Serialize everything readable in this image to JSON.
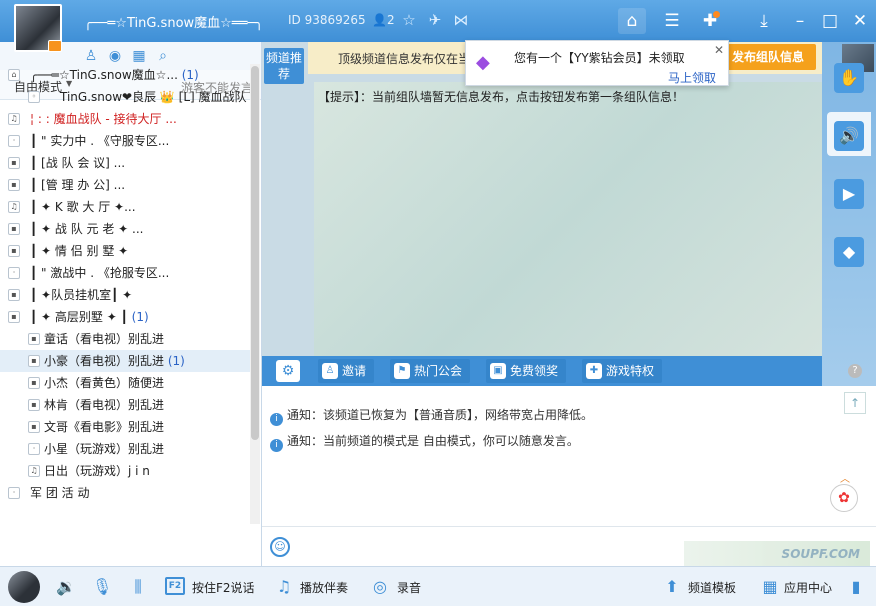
{
  "header": {
    "username": "╭──═☆TinG.snow魔血☆══─╮",
    "id_text": "ID 93869265",
    "online_count": "2"
  },
  "left": {
    "mode_label": "自由模式",
    "guest_note": "游客不能发言",
    "rows": [
      {
        "text": "╭──═☆TinG.snow魔血☆...",
        "count": "(1)",
        "indent": 30,
        "icon": "⌂"
      },
      {
        "text": "TinG.snow❤良辰  👑 [L] 魔血战队",
        "count": "",
        "indent": 60,
        "icon": "◦"
      },
      {
        "text": "¦ : :     魔血战队 - 接待大厅  ...",
        "count": "",
        "indent": 30,
        "icon": "♫"
      },
      {
        "text": "┃       \" 实力中 .  《守服专区...",
        "count": "",
        "indent": 30,
        "icon": "·"
      },
      {
        "text": "┃            [战 队 会 议]   ...",
        "count": "",
        "indent": 30,
        "icon": "▪"
      },
      {
        "text": "┃            [管 理 办 公]   ...",
        "count": "",
        "indent": 30,
        "icon": "▪"
      },
      {
        "text": "┃    ✦     K 歌 大 厅     ✦...",
        "count": "",
        "indent": 30,
        "icon": "♫"
      },
      {
        "text": "┃    ✦    战 队 元 老     ✦ ...",
        "count": "",
        "indent": 30,
        "icon": "▪"
      },
      {
        "text": "┃    ✦     情 侣 别 墅     ✦",
        "count": "",
        "indent": 30,
        "icon": "▪"
      },
      {
        "text": "┃        \" 激战中 .  《抢服专区...",
        "count": "",
        "indent": 30,
        "icon": "·"
      },
      {
        "text": "┃   ✦队员挂机室┃     ✦",
        "count": "",
        "indent": 30,
        "icon": "▪"
      },
      {
        "text": "┃    ✦     高层别墅     ✦    ┃",
        "count": "(1)",
        "indent": 30,
        "icon": "▪"
      },
      {
        "text": "童话（看电视）别乱进",
        "count": "",
        "indent": 44,
        "icon": "▪"
      },
      {
        "text": "小豪（看电视）别乱进",
        "count": "(1)",
        "indent": 44,
        "icon": "▪"
      },
      {
        "text": "小杰（看黄色）随便进",
        "count": "",
        "indent": 44,
        "icon": "▪"
      },
      {
        "text": "林肯（看电视）别乱进",
        "count": "",
        "indent": 44,
        "icon": "▪"
      },
      {
        "text": "文哥《看电影》别乱进",
        "count": "",
        "indent": 44,
        "icon": "▪"
      },
      {
        "text": "小星（玩游戏）别乱进",
        "count": "",
        "indent": 44,
        "icon": "·"
      },
      {
        "text": "日出（玩游戏）j i n",
        "count": "",
        "indent": 44,
        "icon": "♫"
      },
      {
        "text": "            军 团 活 动",
        "count": "",
        "indent": 30,
        "icon": "·"
      }
    ]
  },
  "main": {
    "recommend_label": "频道推荐",
    "banner_text": "顶级频道信息发布仅在当",
    "publish_label": "发布组队信息",
    "hint": "【提示】：当前组队墙暂无信息发布，点击按钮发布第一条组队信息！"
  },
  "popup": {
    "message": "您有一个【YY紫钻会员】未领取",
    "link": "马上领取"
  },
  "toolbar": {
    "invite": "邀请",
    "hot_guild": "热门公会",
    "free_reward": "免费领奖",
    "game_privilege": "游戏特权"
  },
  "messages": [
    "通知：该频道已恢复为【普通音质】，网络带宽占用降低。",
    "通知：当前频道的模式是 自由模式，你可以随意发言。"
  ],
  "bottom": {
    "push_to_talk": "按住F2说话",
    "play_accompaniment": "播放伴奏",
    "record": "录音",
    "channel_template": "频道模板",
    "app_center": "应用中心"
  },
  "watermark": "SOUPF.COM"
}
